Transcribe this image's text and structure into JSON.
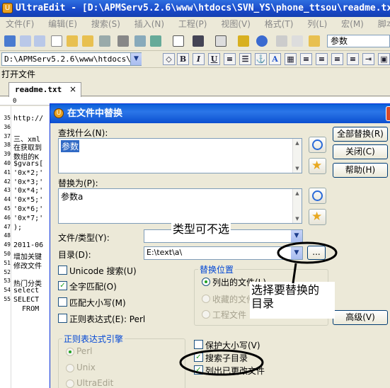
{
  "window": {
    "title": "UltraEdit - [D:\\APMServ5.2.6\\www\\htdocs\\SVN_YS\\phone_ttsou\\readme.txt"
  },
  "menu": [
    "文件(F)",
    "编辑(E)",
    "搜索(S)",
    "插入(N)",
    "工程(P)",
    "视图(V)",
    "格式(T)",
    "列(L)",
    "宏(M)",
    "脚本(I)",
    "高级"
  ],
  "toolbar": {
    "search_value": "参数",
    "path_value": "D:\\APMServ5.2.6\\www\\htdocs\\SVN"
  },
  "open_files_label": "打开文件",
  "tab": {
    "label": "readme.txt",
    "close": "×"
  },
  "ruler_text": "0",
  "editor": {
    "line_numbers": [
      "35",
      "36",
      "37",
      "38",
      "39",
      "40",
      "41",
      "42",
      "43",
      "44",
      "45",
      "46",
      "47",
      "48",
      "49",
      "50",
      "51",
      "52",
      "53",
      "54",
      "55"
    ],
    "lines": [
      "http://",
      "",
      "三、xml",
      "在获取到",
      "数组的K",
      "$gvars[",
      "'0x*2;'",
      "'0x*3;'",
      "'0x*4;'",
      "'0x*5;'",
      "'0x*6;'",
      "'0x*7;'",
      ");",
      "",
      "2011-06",
      "增加关键",
      "修改文件",
      "",
      "热门分类",
      "select ",
      "SELECT ",
      "  FROM "
    ]
  },
  "dialog": {
    "title": "在文件中替换",
    "find_label": "查找什么(N):",
    "find_value": "参数",
    "replace_label": "替换为(P):",
    "replace_value": "参数a",
    "filetype_label": "文件/类型(Y):",
    "filetype_value": "",
    "dir_label": "目录(D):",
    "dir_value": "E:\\text\\a\\",
    "browse": "...",
    "buttons": {
      "replace_all": "全部替换(R)",
      "close": "关闭(C)",
      "help": "帮助(H)",
      "advanced": "高级(V)"
    },
    "options": {
      "unicode": "Unicode 搜索(U)",
      "whole_word": "全字匹配(O)",
      "match_case": "匹配大小写(M)",
      "regex": "正则表达式(E): Perl"
    },
    "replace_where": {
      "title": "替换位置",
      "listed": "列出的文件(L)",
      "favorites": "收藏的文件",
      "project": "工程文件"
    },
    "regex_engine": {
      "title": "正则表达式引擎",
      "perl": "Perl",
      "unix": "Unix",
      "ultraedit": "UltraEdit"
    },
    "bottom_options": {
      "preserve_case": "保护大小写(V)",
      "subdirs": "搜索子目录",
      "list_changed": "列出已更改文件"
    }
  },
  "annotations": {
    "type_note": "类型可不选",
    "dir_note": "选择要替换的\n目录"
  }
}
